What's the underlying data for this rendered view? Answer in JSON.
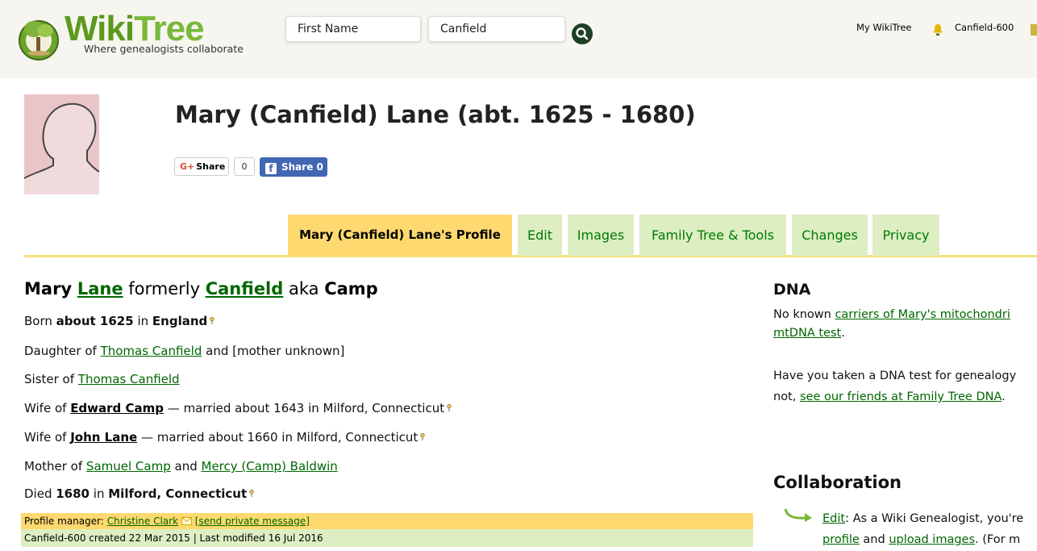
{
  "header": {
    "logo_text_wiki": "Wiki",
    "logo_text_tree": "Tree",
    "tagline": "Where genealogists collaborate",
    "search_first_name": "First Name",
    "search_last_name": "Canfield",
    "my_wikitree": "My WikiTree",
    "user_id": "Canfield-600"
  },
  "profile": {
    "title": "Mary (Canfield) Lane (abt. 1625 - 1680)",
    "share": {
      "google_label": "Share",
      "google_count": "0",
      "facebook_label": "Share 0"
    }
  },
  "tabs": [
    "Mary (Canfield) Lane's Profile",
    "Edit",
    "Images",
    "Family Tree & Tools",
    "Changes",
    "Privacy"
  ],
  "bio": {
    "first": "Mary",
    "last_name": "Lane",
    "formerly": "formerly",
    "birth_name": "Canfield",
    "aka": "aka",
    "aka_name": "Camp",
    "born_prefix": "Born",
    "born_date": "about 1625",
    "born_in": "in",
    "born_place": "England",
    "daughter_prefix": "Daughter of",
    "father": "Thomas Canfield",
    "and_mother": "and [mother unknown]",
    "sister_prefix": "Sister of",
    "sibling": "Thomas Canfield",
    "wife_prefix": "Wife of",
    "spouse1": "Edward Camp",
    "spouse1_detail": "— married about 1643 in Milford, Connecticut",
    "spouse2": "John Lane",
    "spouse2_detail": "— married about 1660 in Milford, Connecticut",
    "mother_prefix": "Mother of",
    "child1": "Samuel Camp",
    "and": "and",
    "child2": "Mercy (Camp) Baldwin",
    "died_prefix": "Died",
    "died_date": "1680",
    "died_in": "in",
    "died_place": "Milford, Connecticut",
    "manager_prefix": "Profile manager:",
    "manager_name": "Christine Clark",
    "send_message": "[send private message]",
    "created_line": "Canfield-600 created 22 Mar 2015 | Last modified 16 Jul 2016"
  },
  "sidebar": {
    "dna_heading": "DNA",
    "dna_line1_prefix": "No known",
    "dna_line1_link": "carriers of Mary's mitochondri",
    "dna_line2_link": "mtDNA test",
    "dna_line2_suffix": ".",
    "dna_line3": "Have you taken a DNA test for genealogy",
    "dna_line4_prefix": "not,",
    "dna_line4_link": "see our friends at Family Tree DNA",
    "dna_line4_suffix": ".",
    "collab_heading": "Collaboration",
    "collab_edit_link": "Edit",
    "collab_line1": ": As a Wiki Genealogist, you're",
    "collab_profile_link": "profile",
    "collab_and": "and",
    "collab_upload_link": "upload images",
    "collab_line2_suffix": ". (For m"
  },
  "colors": {
    "header_bg": "#f7f5ef",
    "tab_active": "#fdd96f",
    "tab_inactive": "#ddeec3",
    "link_green": "#006600",
    "logo_green": "#5c9a1f"
  }
}
